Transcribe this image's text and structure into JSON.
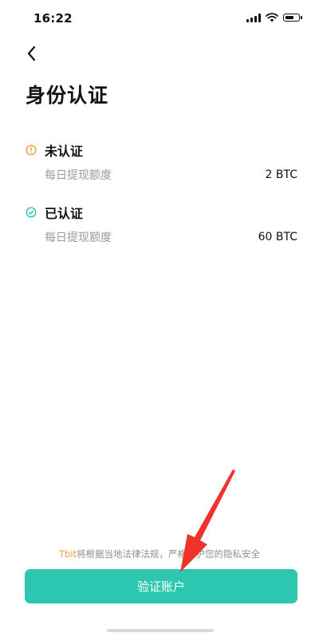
{
  "status_bar": {
    "time": "16:22",
    "icons": [
      "signal-icon",
      "wifi-icon",
      "battery-icon"
    ]
  },
  "header": {
    "back_icon": "chevron-left-icon",
    "title": "身份认证"
  },
  "levels": [
    {
      "status": "未认证",
      "icon": "alert-circle-icon",
      "icon_color": "#e8a23a",
      "limit_label": "每日提现额度",
      "limit_value": "2 BTC"
    },
    {
      "status": "已认证",
      "icon": "check-circle-icon",
      "icon_color": "#2dc6b0",
      "limit_label": "每日提现额度",
      "limit_value": "60 BTC"
    }
  ],
  "footer": {
    "brand": "Tbit",
    "privacy_note": "将根据当地法律法规，严格保护您的隐私安全",
    "button_label": "验证账户"
  },
  "colors": {
    "accent": "#2dc6b0",
    "warning": "#e8a23a",
    "annotation_arrow": "#f0322d"
  }
}
